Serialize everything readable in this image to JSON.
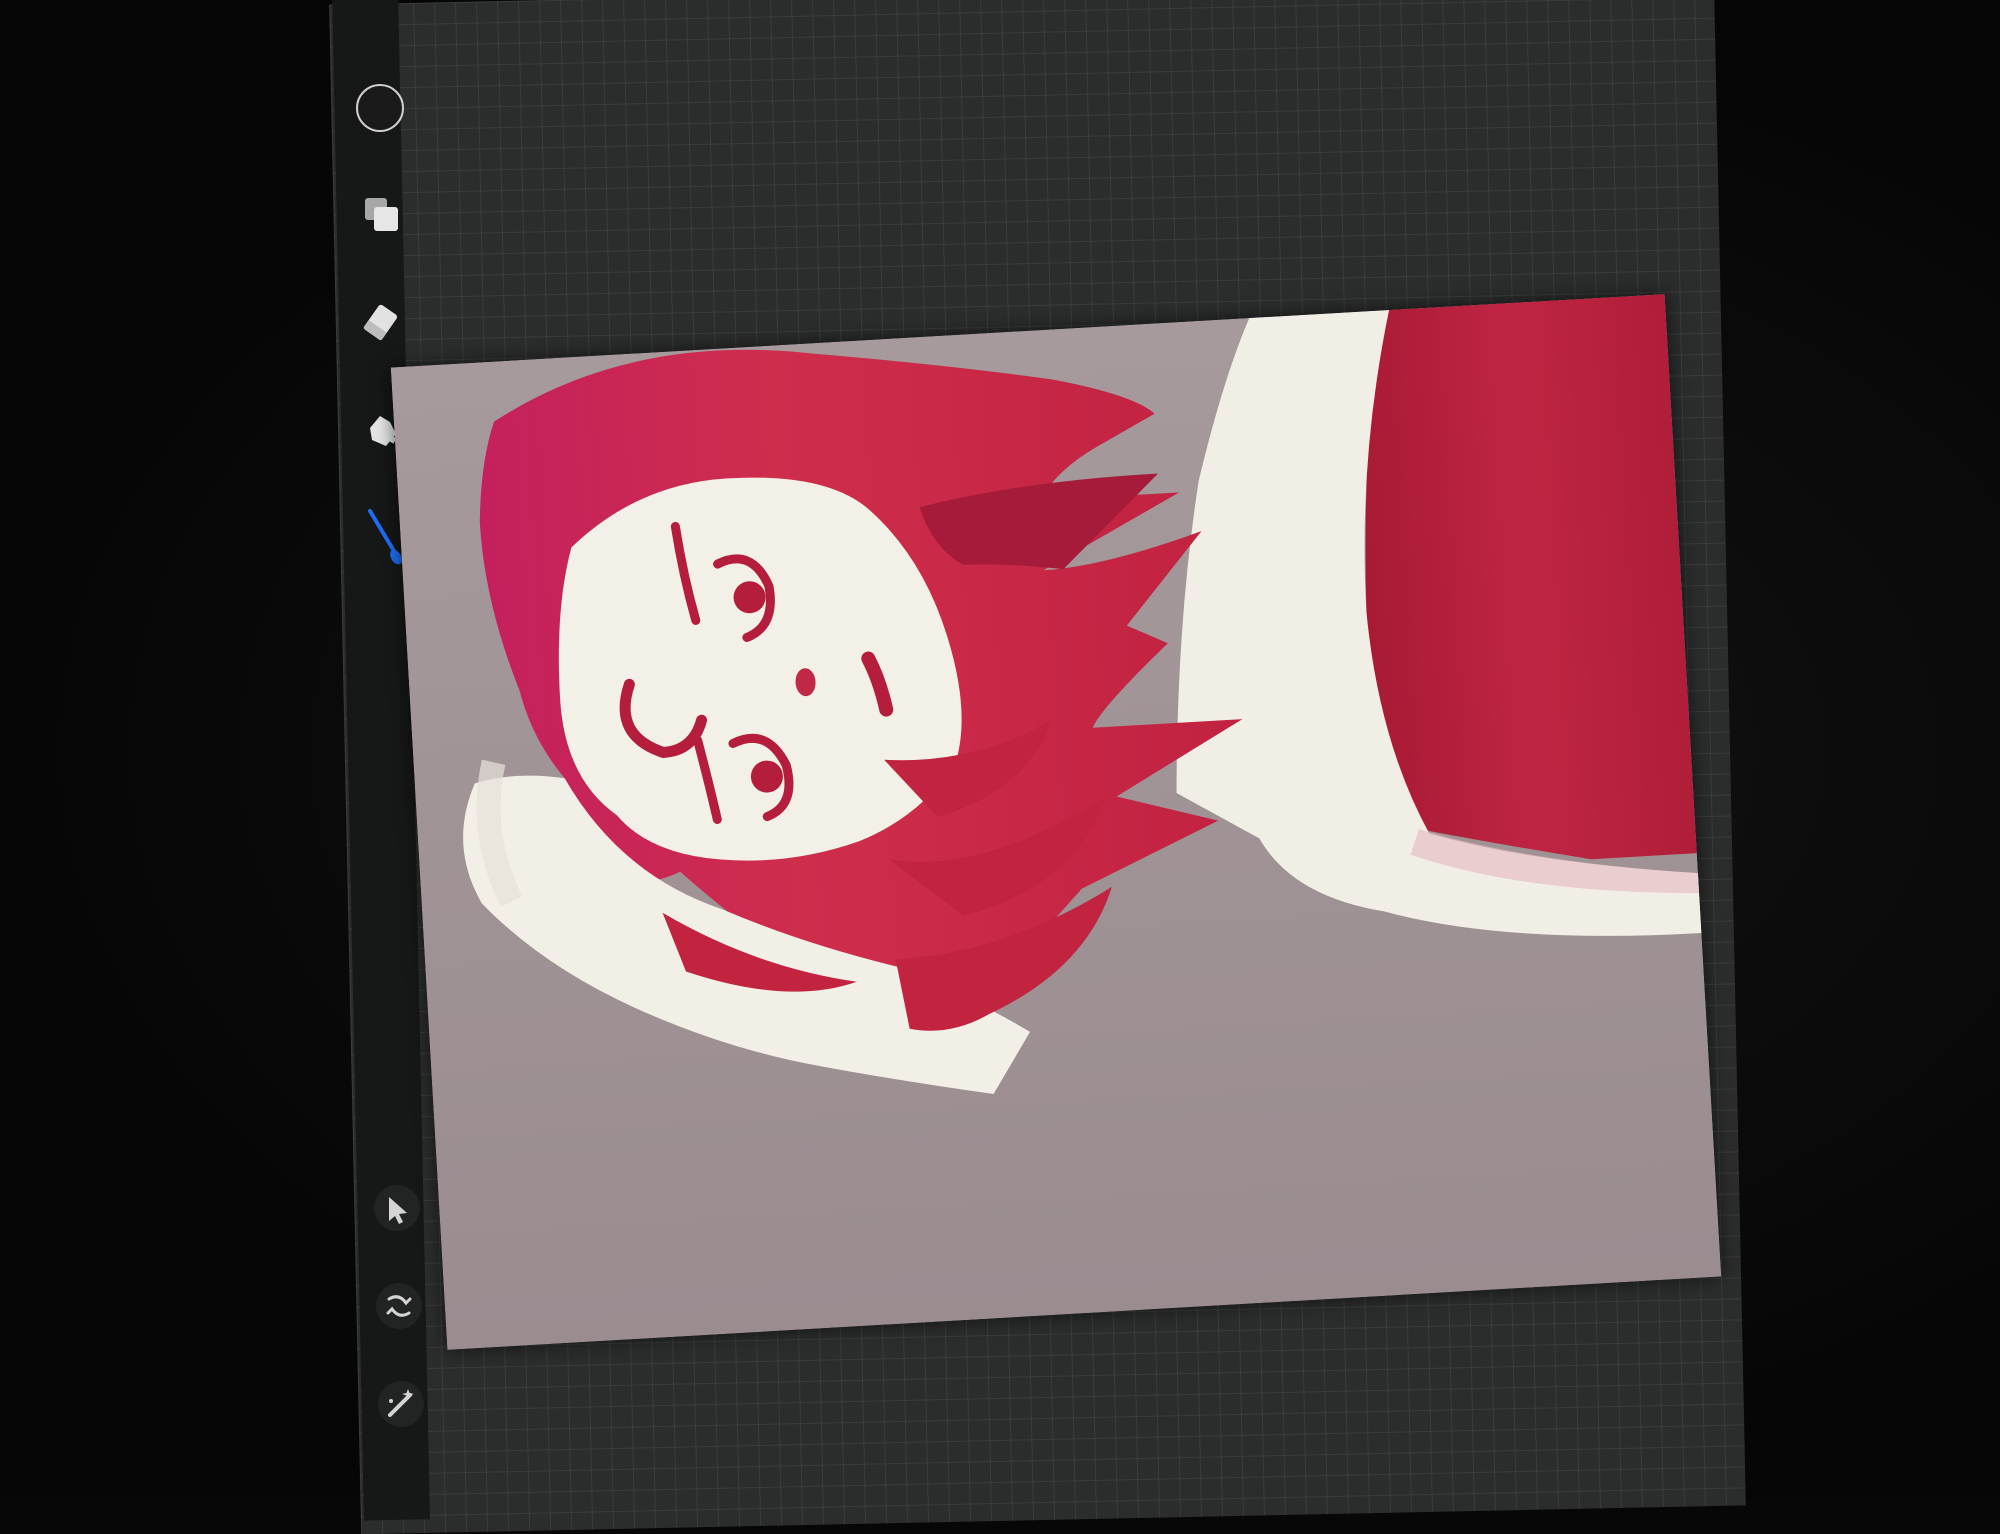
{
  "app": {
    "colors": {
      "background": "#9e8f92",
      "skin": "#f2efe6",
      "hair_magenta": "#c8245c",
      "hair_red": "#b8213c",
      "shirt_red": "#b11d38",
      "accent_blue": "#1e6cf2"
    }
  },
  "sidebar": {
    "tools": [
      {
        "name": "color-picker-icon"
      },
      {
        "name": "layers-icon"
      },
      {
        "name": "eraser-icon"
      },
      {
        "name": "smudge-icon"
      },
      {
        "name": "brush-icon",
        "active": true
      }
    ],
    "bottom_tools": [
      {
        "name": "selection-arrow-icon"
      },
      {
        "name": "transform-icon"
      },
      {
        "name": "adjustments-wand-icon"
      }
    ]
  },
  "canvas": {
    "content": "portrait-painting",
    "orientation": "rotated-90"
  }
}
